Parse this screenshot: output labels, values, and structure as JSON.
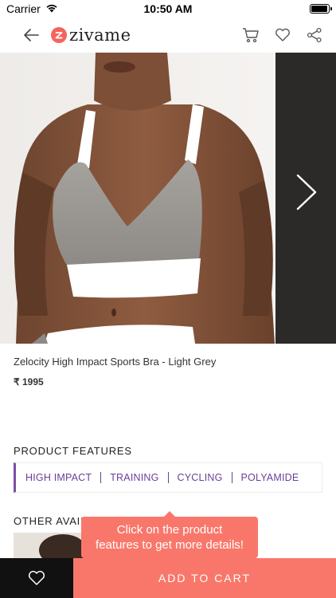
{
  "status_bar": {
    "carrier": "Carrier",
    "time": "10:50 AM",
    "battery_level": 0.85
  },
  "nav": {
    "logo_text": "zivame",
    "logo_letter": "z"
  },
  "product": {
    "title": "Zelocity High Impact Sports Bra - Light Grey",
    "price": "₹ 1995"
  },
  "features": {
    "heading": "PRODUCT FEATURES",
    "tags": [
      "HIGH IMPACT",
      "TRAINING",
      "CYCLING",
      "POLYAMIDE"
    ]
  },
  "other": {
    "heading": "OTHER AVAIL"
  },
  "tooltip": {
    "line1": "Click on the product",
    "line2": "features to get more details!"
  },
  "bottom_bar": {
    "add_to_cart_label": "ADD TO CART"
  },
  "colors": {
    "accent_purple": "#7b4fa5",
    "coral": "#f9776a",
    "logo_red": "#f4645f",
    "dark": "#111111"
  }
}
